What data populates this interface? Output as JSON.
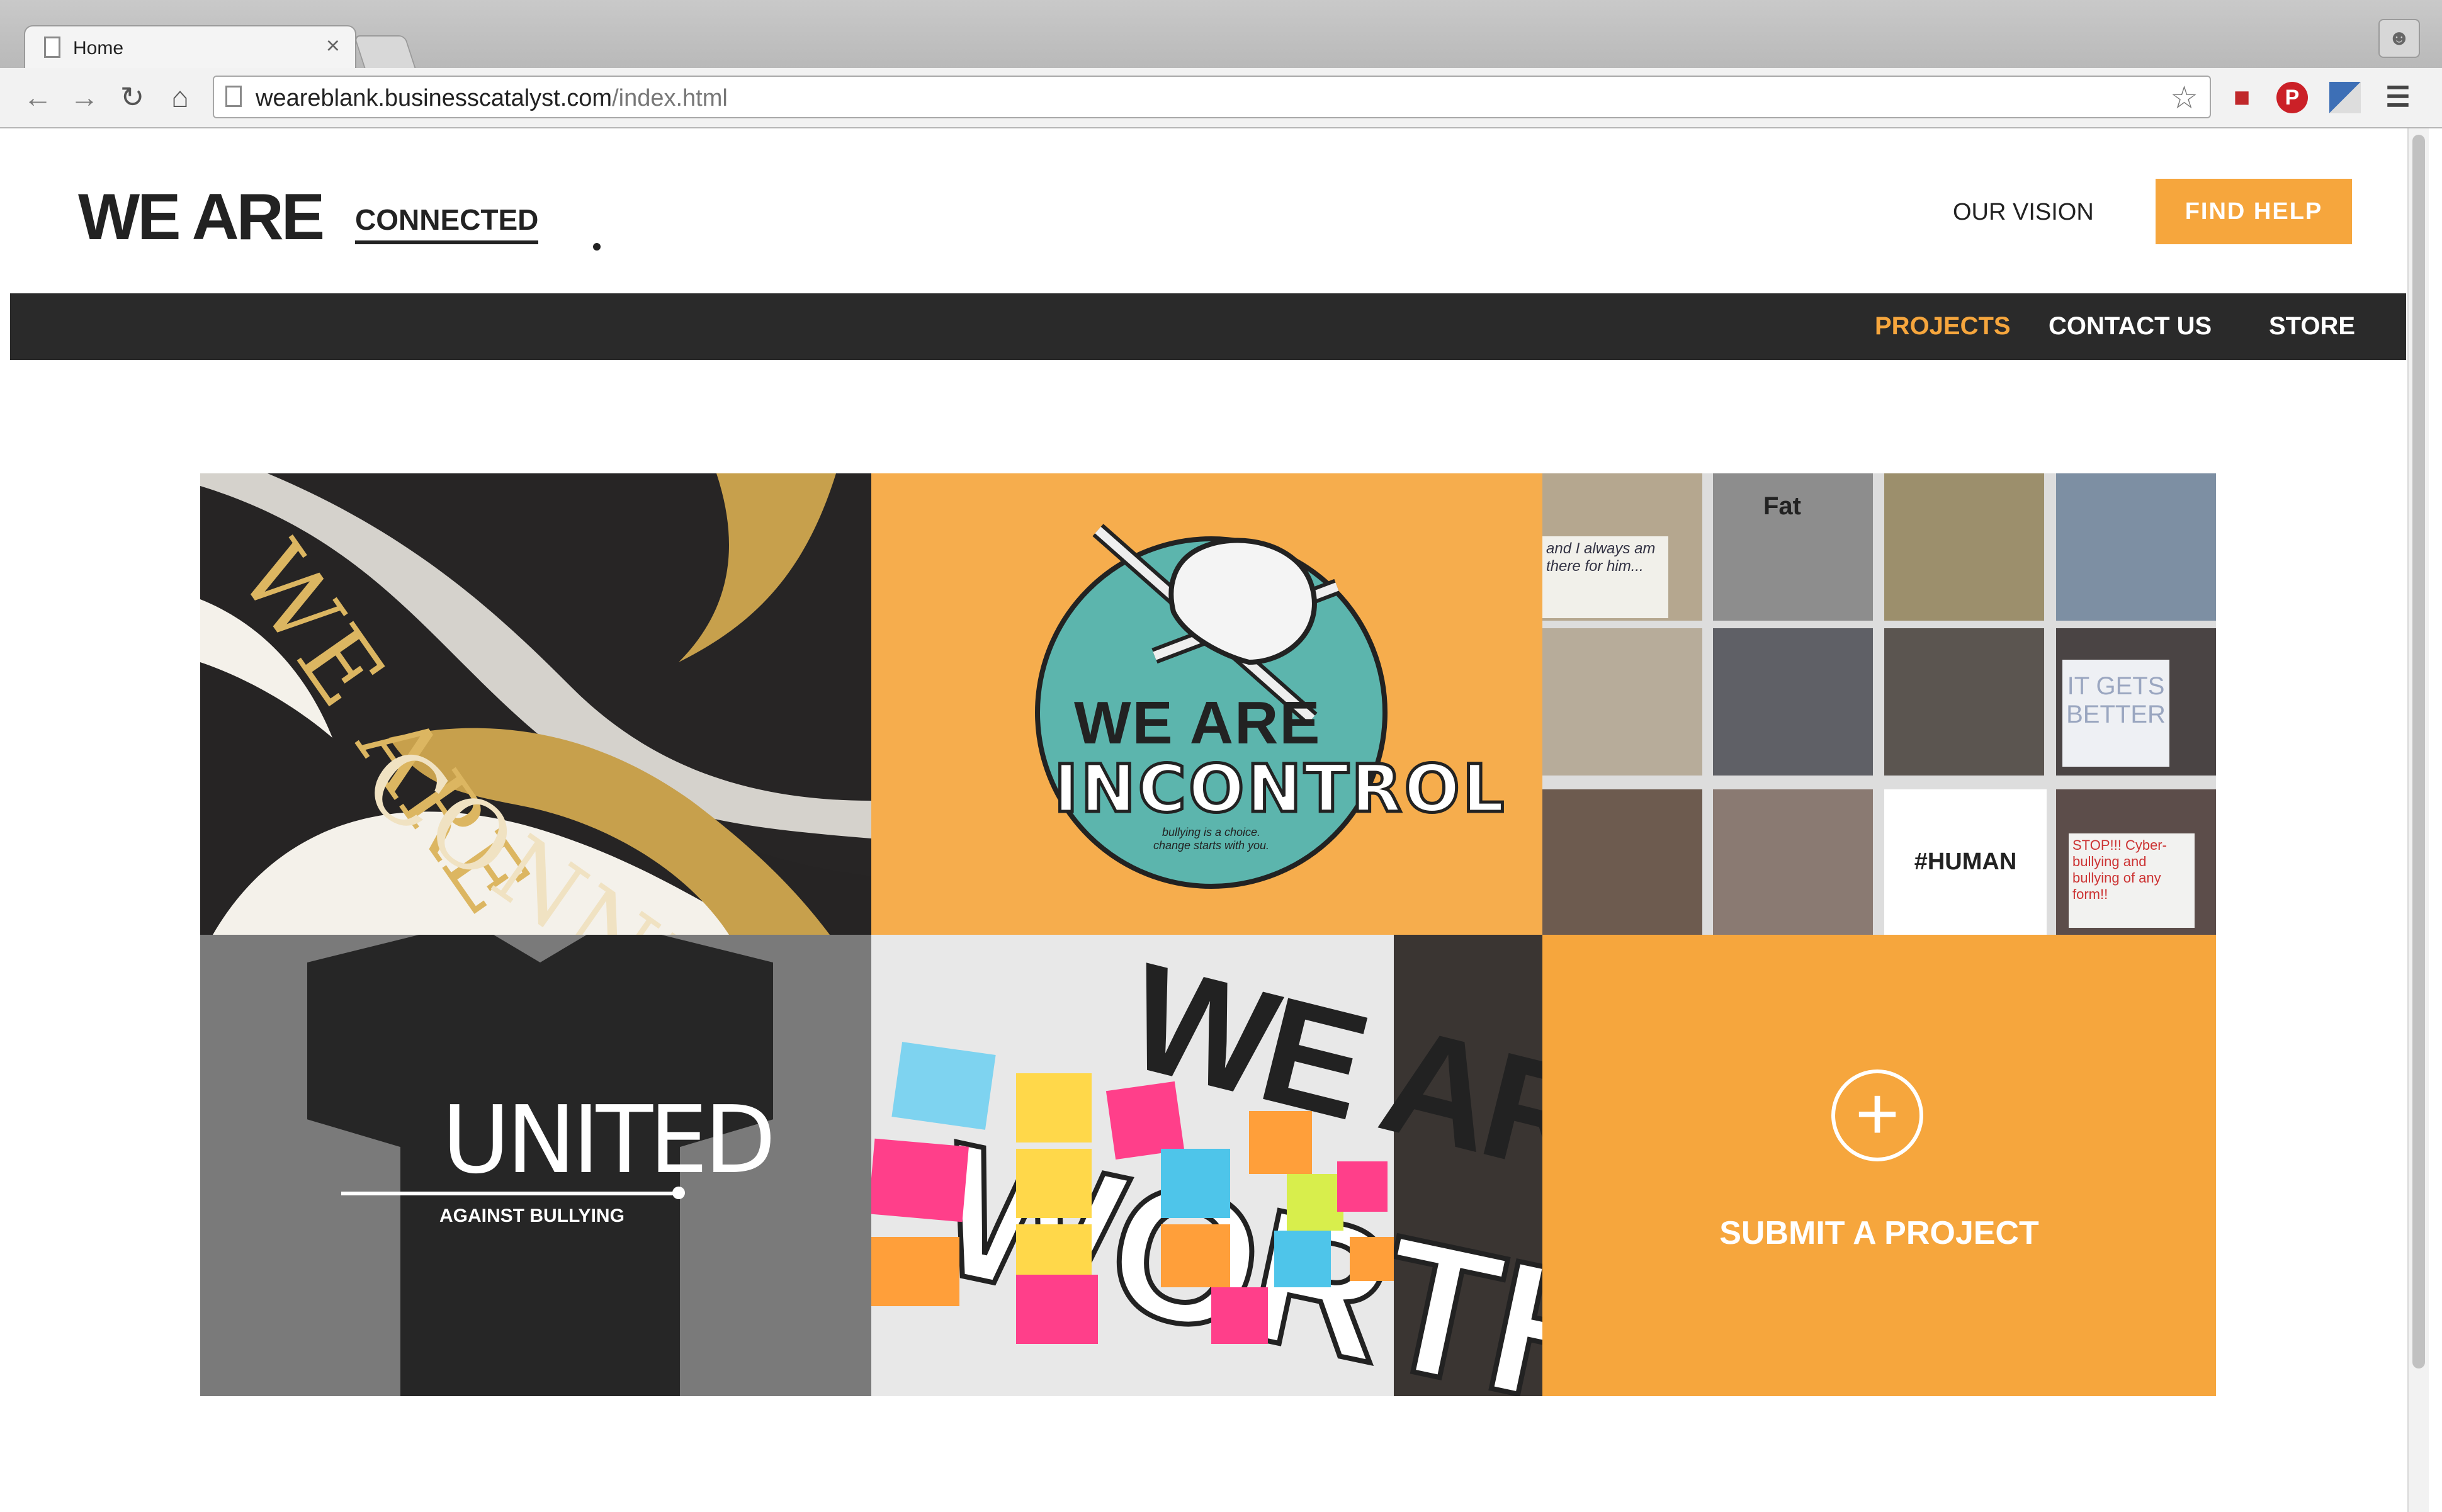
{
  "browser": {
    "tab_title": "Home",
    "tab_close": "×",
    "url_host": "weareblank.businesscatalyst.com",
    "url_path": "/index.html",
    "nav_icons": [
      "back-arrow-icon",
      "forward-arrow-icon",
      "reload-icon",
      "home-icon"
    ],
    "extension_icons": [
      "red-couch-icon",
      "pinterest-icon",
      "image-extension-icon",
      "menu-icon"
    ]
  },
  "header": {
    "logo_big": "WE ARE",
    "logo_small": "CONNECTED",
    "our_vision": "OUR VISION",
    "find_help": "FIND HELP"
  },
  "nav": {
    "items": [
      {
        "label": "PROJECTS",
        "active": true
      },
      {
        "label": "CONTACT US",
        "active": false
      },
      {
        "label": "STORE",
        "active": false
      }
    ]
  },
  "tiles": {
    "connected": {
      "line1": "WE ARE",
      "line2": "CONNECTED"
    },
    "in_control": {
      "line1": "WE ARE",
      "line2": "INCONTROL",
      "tagline": "bullying is a choice. change starts with you."
    },
    "human": {
      "hashtag": "#HUMAN",
      "photo_texts": [
        "and I always am there for him...",
        "Fat",
        "IT GETS BETTER",
        "STOP!!! Cyber-bullying and bullying of any form!!"
      ]
    },
    "united": {
      "line1": "UNITED",
      "line2": "AGAINST BULLYING"
    },
    "worthy": {
      "line1": "WE ARE",
      "line2": "WORTHY"
    },
    "submit": {
      "label": "SUBMIT A PROJECT",
      "icon": "plus-circle-icon"
    }
  },
  "colors": {
    "accent": "#f6a63d",
    "nav_bg": "#2a2a2a",
    "teal": "#5cb5ad",
    "gold": "#dcb661"
  }
}
